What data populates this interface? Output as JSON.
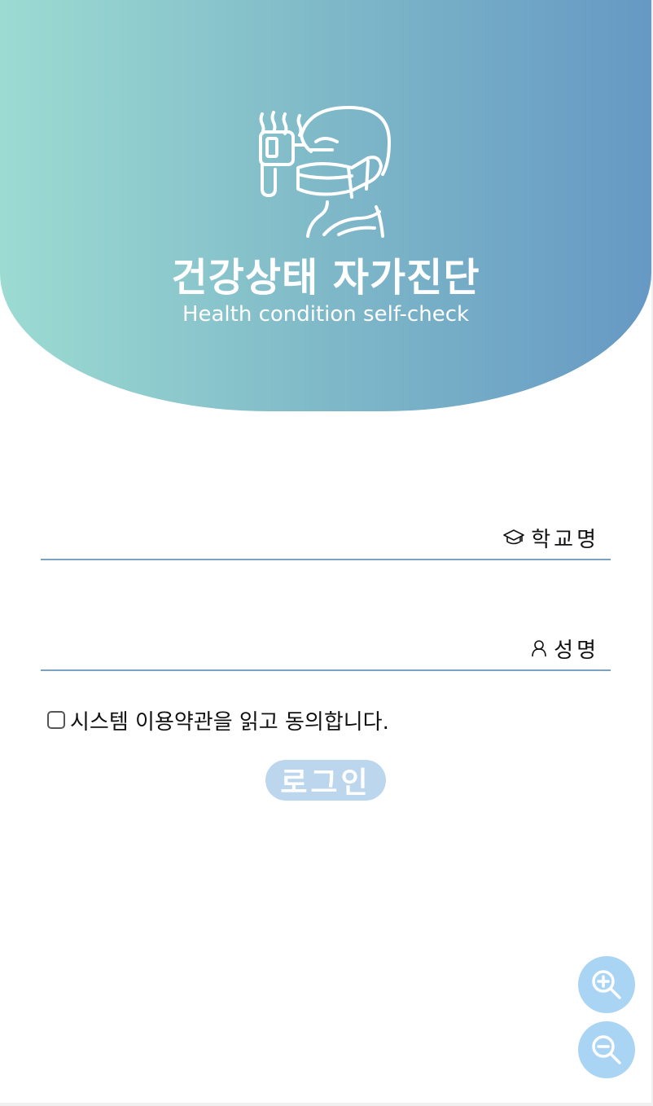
{
  "header": {
    "title": "건강상태 자가진단",
    "subtitle": "Health condition self-check",
    "illustration_icon": "masked-person-thermometer-icon",
    "gradient_colors": [
      "#9cdbd2",
      "#6699c4"
    ]
  },
  "form": {
    "school_field": {
      "label": "학교명",
      "icon": "graduation-cap-icon",
      "value": ""
    },
    "name_field": {
      "label": "성명",
      "icon": "user-icon",
      "value": ""
    },
    "agreement": {
      "label": "시스템 이용약관을 읽고 동의합니다.",
      "checked": false
    },
    "login_button": {
      "label": "로그인",
      "color": "#bcd6ee"
    }
  },
  "zoom_controls": {
    "zoom_in_icon": "zoom-in-icon",
    "zoom_out_icon": "zoom-out-icon",
    "color": "#a9d4f3"
  }
}
